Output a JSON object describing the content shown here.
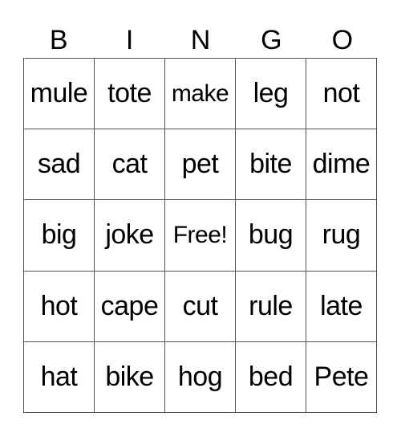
{
  "header": [
    "B",
    "I",
    "N",
    "G",
    "O"
  ],
  "rows": [
    [
      "mule",
      "tote",
      "make",
      "leg",
      "not"
    ],
    [
      "sad",
      "cat",
      "pet",
      "bite",
      "dime"
    ],
    [
      "big",
      "joke",
      "Free!",
      "bug",
      "rug"
    ],
    [
      "hot",
      "cape",
      "cut",
      "rule",
      "late"
    ],
    [
      "hat",
      "bike",
      "hog",
      "bed",
      "Pete"
    ]
  ]
}
